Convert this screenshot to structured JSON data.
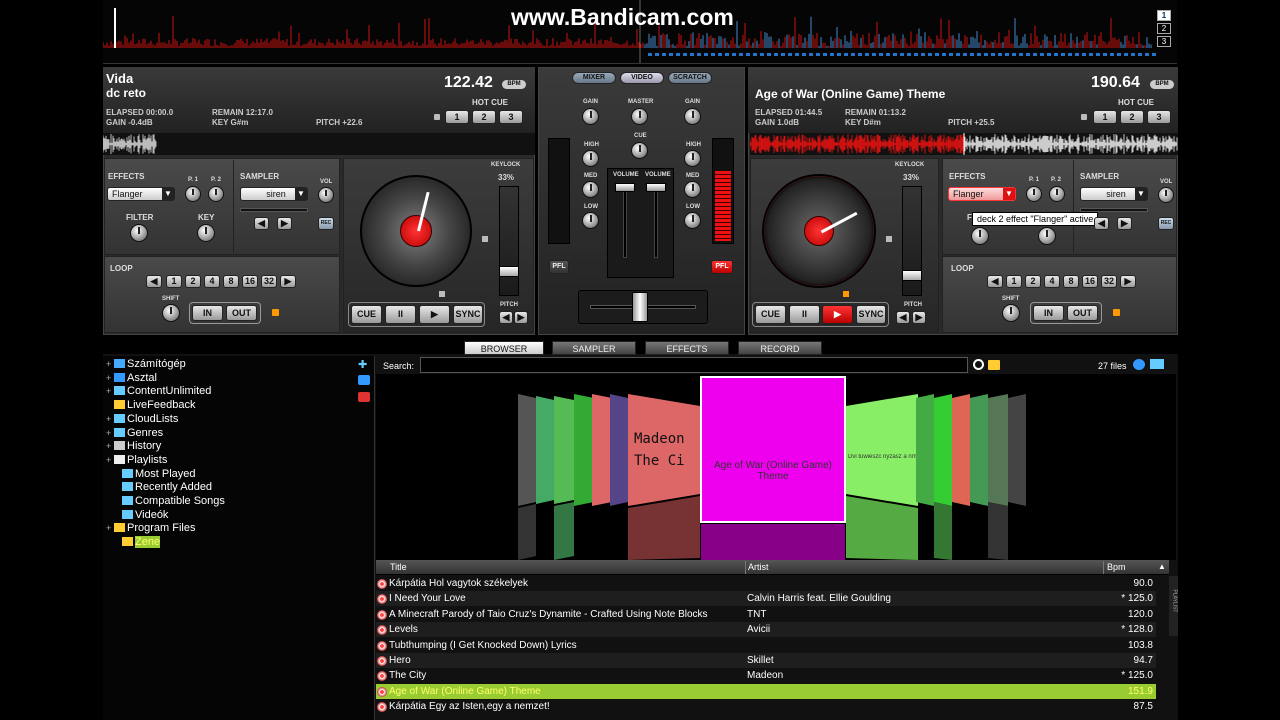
{
  "watermark": "www.Bandicam.com",
  "waveform_overview": {
    "deck_buttons": [
      "1",
      "2",
      "3"
    ]
  },
  "deck1": {
    "title": "Vida",
    "artist": "dc reto",
    "bpm": "122.42",
    "bpm_badge": "BPM",
    "elapsed": "ELAPSED 00:00.0",
    "remain": "REMAIN 12:17.0",
    "gain": "GAIN -0.4dB",
    "key": "KEY G#m",
    "pitch": "PITCH +22.6",
    "hot_cue_label": "HOT CUE",
    "hot_cues": [
      "1",
      "2",
      "3"
    ],
    "effects_label": "EFFECTS",
    "effect": "Flanger",
    "p1": "P. 1",
    "p2": "P. 2",
    "sampler_label": "SAMPLER",
    "sample": "siren",
    "vol": "VOL",
    "filter": "FILTER",
    "key_label": "KEY",
    "rec": "REC",
    "loop_label": "LOOP",
    "loop_values": [
      "1",
      "2",
      "4",
      "8",
      "16",
      "32"
    ],
    "shift": "SHIFT",
    "in": "IN",
    "out": "OUT",
    "keylock": "KEYLOCK",
    "keylock_pct": "33%",
    "pitch_label": "PITCH",
    "transport": [
      "CUE",
      "II",
      "▶",
      "SYNC"
    ]
  },
  "deck2": {
    "title": "Age of War (Online Game) Theme",
    "bpm": "190.64",
    "bpm_badge": "BPM",
    "elapsed": "ELAPSED 01:44.5",
    "remain": "REMAIN 01:13.2",
    "gain": "GAIN 1.0dB",
    "key": "KEY D#m",
    "pitch": "PITCH +25.5",
    "hot_cue_label": "HOT CUE",
    "hot_cues": [
      "1",
      "2",
      "3"
    ],
    "effects_label": "EFFECTS",
    "effect": "Flanger",
    "p1": "P. 1",
    "p2": "P. 2",
    "sampler_label": "SAMPLER",
    "sample": "siren",
    "vol": "VOL",
    "filter": "F",
    "rec": "REC",
    "tooltip": "deck 2 effect \"Flanger\" active",
    "loop_label": "LOOP",
    "loop_values": [
      "1",
      "2",
      "4",
      "8",
      "16",
      "32"
    ],
    "shift": "SHIFT",
    "in": "IN",
    "out": "OUT",
    "keylock": "KEYLOCK",
    "keylock_pct": "33%",
    "pitch_label": "PITCH",
    "transport": [
      "CUE",
      "II",
      "▶",
      "SYNC"
    ]
  },
  "mixer": {
    "tabs": [
      "MIXER",
      "VIDEO",
      "SCRATCH"
    ],
    "gain": "GAIN",
    "master": "MASTER",
    "cue": "CUE",
    "high": "HIGH",
    "med": "MED",
    "low": "LOW",
    "volume": "VOLUME",
    "pfl": "PFL"
  },
  "browser_tabs": [
    "BROWSER",
    "SAMPLER",
    "EFFECTS",
    "RECORD"
  ],
  "tree": [
    {
      "label": "Számítógép",
      "exp": "+",
      "color": "#4af"
    },
    {
      "label": "Asztal",
      "exp": "+",
      "color": "#39f"
    },
    {
      "label": "ContentUnlimited",
      "exp": "+",
      "color": "#6cf"
    },
    {
      "label": "LiveFeedback",
      "exp": "",
      "color": "#fc3"
    },
    {
      "label": "CloudLists",
      "exp": "+",
      "color": "#6cf"
    },
    {
      "label": "Genres",
      "exp": "+",
      "color": "#6cf"
    },
    {
      "label": "History",
      "exp": "+",
      "color": "#ccc"
    },
    {
      "label": "Playlists",
      "exp": "+",
      "color": "#eee"
    },
    {
      "label": "Most Played",
      "exp": "",
      "color": "#6cf"
    },
    {
      "label": "Recently Added",
      "exp": "",
      "color": "#6cf"
    },
    {
      "label": "Compatible Songs",
      "exp": "",
      "color": "#6cf"
    },
    {
      "label": "Videók",
      "exp": "",
      "color": "#6cf"
    },
    {
      "label": "Program Files",
      "exp": "+",
      "color": "#fc3"
    },
    {
      "label": "Zene",
      "exp": "",
      "color": "#fc3"
    }
  ],
  "search": {
    "label": "Search:",
    "value": "",
    "file_count": "27 files"
  },
  "coverflow": {
    "center_title": "Age of War (Online Game) Theme",
    "left_text_1": "Madeon",
    "left_text_2": "The Ci",
    "right_text": "Dvi tuwieszc nyzasz a nmczet"
  },
  "table": {
    "headers": {
      "title": "Title",
      "artist": "Artist",
      "bpm": "Bpm"
    },
    "side_label": "PLAYLIST",
    "rows": [
      {
        "title": "Kárpátia Hol vagytok székelyek",
        "artist": "",
        "bpm": "90.0"
      },
      {
        "title": "I Need Your Love",
        "artist": "Calvin Harris feat. Ellie Goulding",
        "bpm": "* 125.0"
      },
      {
        "title": "A Minecraft Parody of Taio Cruz's Dynamite - Crafted Using Note Blocks",
        "artist": "TNT",
        "bpm": "120.0"
      },
      {
        "title": "Levels",
        "artist": "Avicii",
        "bpm": "* 128.0"
      },
      {
        "title": "Tubthumping (I Get Knocked Down) Lyrics",
        "artist": "",
        "bpm": "103.8"
      },
      {
        "title": "Hero",
        "artist": "Skillet",
        "bpm": "94.7"
      },
      {
        "title": "The City",
        "artist": "Madeon",
        "bpm": "* 125.0"
      },
      {
        "title": "Age of War (Online Game) Theme",
        "artist": "",
        "bpm": "151.9"
      },
      {
        "title": "Kárpátia Egy az Isten,egy a nemzet!",
        "artist": "",
        "bpm": "87.5"
      }
    ]
  },
  "colors": {
    "accent_red": "#d11",
    "highlight_row": "#9c3",
    "cover_center": "#e0e"
  }
}
